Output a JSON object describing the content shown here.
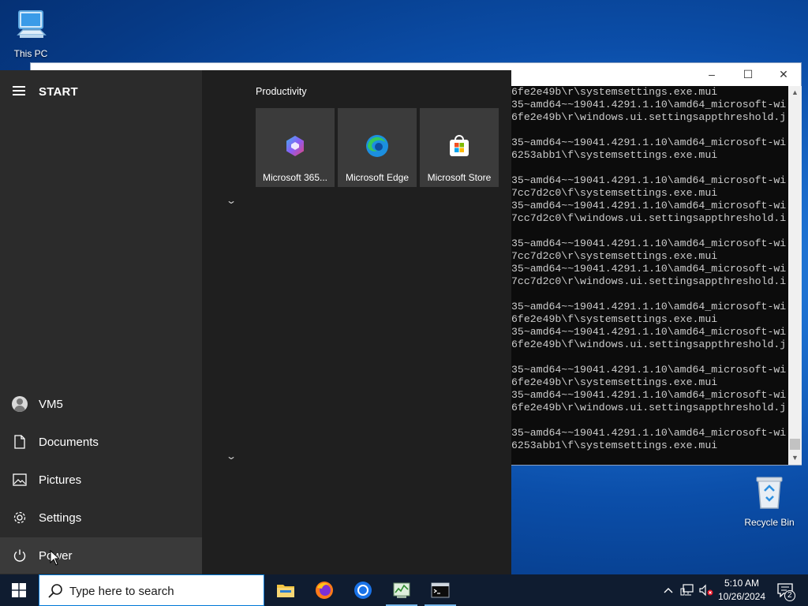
{
  "desktop": {
    "icons": [
      {
        "label": "This PC",
        "icon": "this-pc-icon"
      },
      {
        "label": "Recycle Bin",
        "icon": "recycle-bin-icon"
      }
    ]
  },
  "console": {
    "controls": {
      "minimize": "–",
      "maximize": "☐",
      "close": "✕"
    },
    "lines": [
      "6fe2e49b\\r\\systemsettings.exe.mui",
      "35~amd64~~19041.4291.1.10\\amd64_microsoft-wi",
      "6fe2e49b\\r\\windows.ui.settingsappthreshold.j",
      "",
      "35~amd64~~19041.4291.1.10\\amd64_microsoft-wi",
      "6253abb1\\f\\systemsettings.exe.mui",
      "",
      "35~amd64~~19041.4291.1.10\\amd64_microsoft-wi",
      "7cc7d2c0\\f\\systemsettings.exe.mui",
      "35~amd64~~19041.4291.1.10\\amd64_microsoft-wi",
      "7cc7d2c0\\f\\windows.ui.settingsappthreshold.i",
      "",
      "35~amd64~~19041.4291.1.10\\amd64_microsoft-wi",
      "7cc7d2c0\\r\\systemsettings.exe.mui",
      "35~amd64~~19041.4291.1.10\\amd64_microsoft-wi",
      "7cc7d2c0\\r\\windows.ui.settingsappthreshold.i",
      "",
      "35~amd64~~19041.4291.1.10\\amd64_microsoft-wi",
      "6fe2e49b\\f\\systemsettings.exe.mui",
      "35~amd64~~19041.4291.1.10\\amd64_microsoft-wi",
      "6fe2e49b\\f\\windows.ui.settingsappthreshold.j",
      "",
      "35~amd64~~19041.4291.1.10\\amd64_microsoft-wi",
      "6fe2e49b\\r\\systemsettings.exe.mui",
      "35~amd64~~19041.4291.1.10\\amd64_microsoft-wi",
      "6fe2e49b\\r\\windows.ui.settingsappthreshold.j",
      "",
      "35~amd64~~19041.4291.1.10\\amd64_microsoft-wi",
      "6253abb1\\f\\systemsettings.exe.mui"
    ]
  },
  "start_menu": {
    "title": "START",
    "sidebar": [
      {
        "label": "VM5",
        "icon": "user-avatar-icon"
      },
      {
        "label": "Documents",
        "icon": "document-icon"
      },
      {
        "label": "Pictures",
        "icon": "pictures-icon"
      },
      {
        "label": "Settings",
        "icon": "gear-icon"
      },
      {
        "label": "Power",
        "icon": "power-icon"
      }
    ],
    "group": {
      "title": "Productivity",
      "tiles": [
        {
          "label": "Microsoft 365...",
          "icon": "microsoft-365-icon"
        },
        {
          "label": "Microsoft Edge",
          "icon": "edge-icon"
        },
        {
          "label": "Microsoft Store",
          "icon": "store-icon"
        }
      ]
    },
    "collapse_glyph": "⌄"
  },
  "taskbar": {
    "search_placeholder": "Type here to search",
    "apps": [
      {
        "name": "file-explorer",
        "icon": "folder-icon"
      },
      {
        "name": "firefox",
        "icon": "firefox-icon"
      },
      {
        "name": "chrome",
        "icon": "chrome-icon"
      },
      {
        "name": "task-manager",
        "icon": "task-manager-icon"
      },
      {
        "name": "command-prompt",
        "icon": "terminal-icon"
      }
    ],
    "clock": {
      "time": "5:10 AM",
      "date": "10/26/2024"
    },
    "notification_count": "2"
  },
  "colors": {
    "accent": "#0078d7",
    "start_left_bg": "#2b2b2b",
    "start_right_bg": "#1f1f1f",
    "tile_bg": "#3b3b3b",
    "taskbar_bg": "#0f1c30",
    "console_bg": "#0c0c0c"
  }
}
